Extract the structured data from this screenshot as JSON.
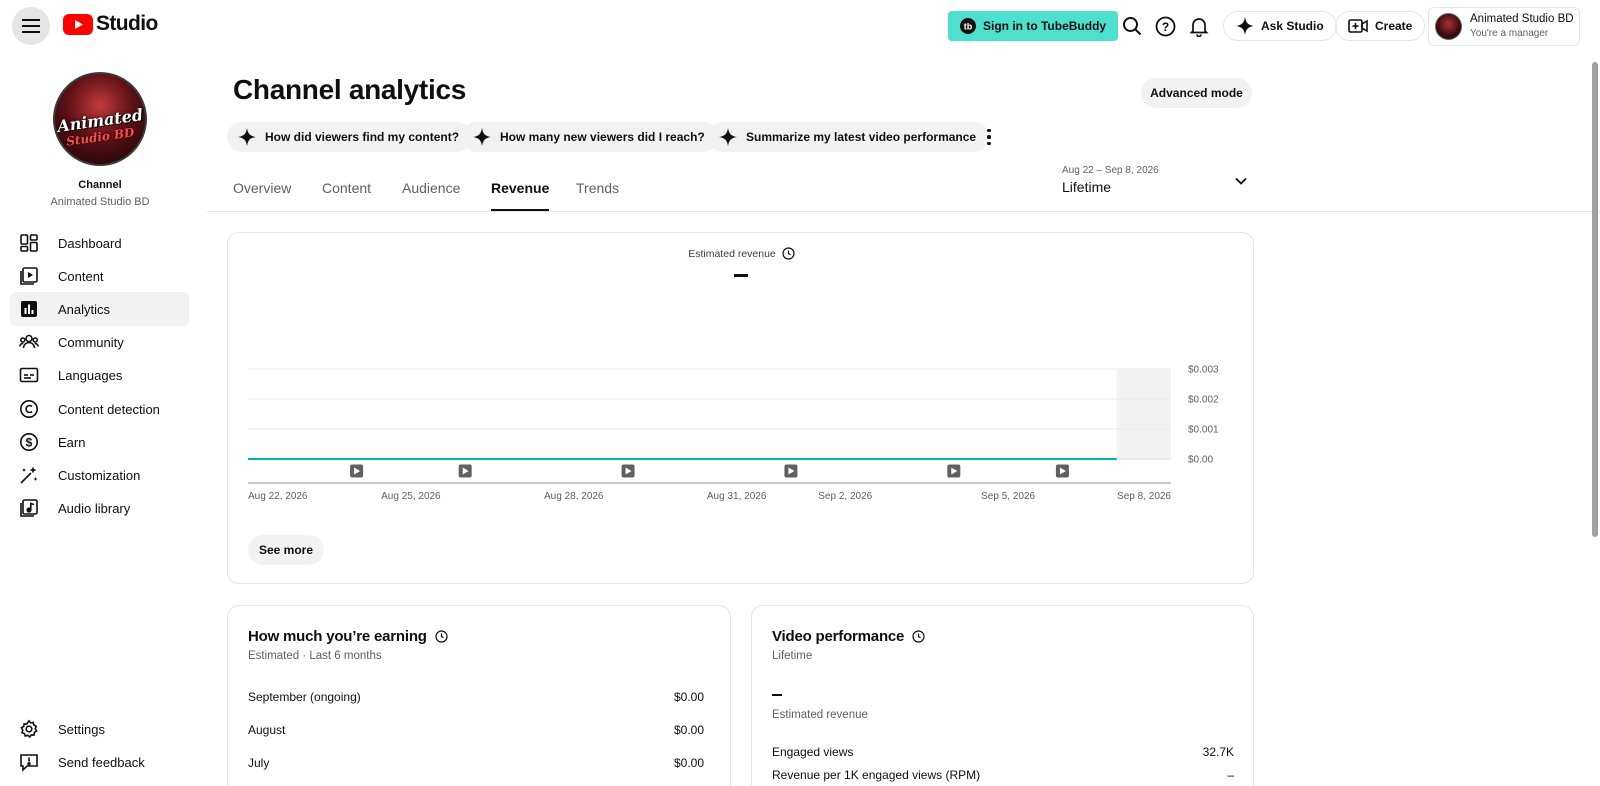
{
  "app": {
    "brand": "Studio",
    "tubebuddy_label": "Sign in to TubeBuddy",
    "ask_studio_label": "Ask Studio",
    "create_label": "Create",
    "account_name": "Animated Studio BD",
    "account_role": "You're a manager",
    "brand_color": "#ff0000",
    "tubebuddy_color": "#4de0cf"
  },
  "sidebar": {
    "channel_label": "Channel",
    "channel_name": "Animated Studio BD",
    "avatar_text_1": "Animated",
    "avatar_text_2": "Studio BD",
    "items": [
      {
        "label": "Dashboard",
        "icon": "dashboard-icon"
      },
      {
        "label": "Content",
        "icon": "content-icon"
      },
      {
        "label": "Analytics",
        "icon": "analytics-icon",
        "active": true
      },
      {
        "label": "Community",
        "icon": "community-icon"
      },
      {
        "label": "Languages",
        "icon": "languages-icon"
      },
      {
        "label": "Content detection",
        "icon": "copyright-icon"
      },
      {
        "label": "Earn",
        "icon": "earn-icon"
      },
      {
        "label": "Customization",
        "icon": "customization-icon"
      },
      {
        "label": "Audio library",
        "icon": "audio-library-icon"
      }
    ],
    "footer": [
      {
        "label": "Settings",
        "icon": "gear-icon"
      },
      {
        "label": "Send feedback",
        "icon": "feedback-icon"
      }
    ]
  },
  "main": {
    "title": "Channel analytics",
    "advanced_mode": "Advanced mode",
    "chips": [
      "How did viewers find my content?",
      "How many new viewers did I reach?",
      "Summarize my latest video performance"
    ],
    "tabs": [
      "Overview",
      "Content",
      "Audience",
      "Revenue",
      "Trends"
    ],
    "active_tab": "Revenue",
    "date_range": {
      "dates": "Aug 22 – Sep 8, 2026",
      "period": "Lifetime"
    }
  },
  "chart": {
    "metric_label": "Estimated revenue",
    "see_more": "See more"
  },
  "chart_data": {
    "type": "line",
    "title": "Estimated revenue",
    "x_ticks": [
      "Aug 22, 2026",
      "Aug 25, 2026",
      "Aug 28, 2026",
      "Aug 31, 2026",
      "Sep 2, 2026",
      "Sep 5, 2026",
      "Sep 8, 2026"
    ],
    "y_ticks": [
      "$0.003",
      "$0.002",
      "$0.001",
      "$0.00"
    ],
    "ylim": [
      0,
      0.003
    ],
    "x_start": "2026-08-22",
    "x_end": "2026-09-08",
    "series": [
      {
        "color": "#00b3a4",
        "x": [
          "2026-08-22",
          "2026-08-23",
          "2026-08-24",
          "2026-08-25",
          "2026-08-26",
          "2026-08-27",
          "2026-08-28",
          "2026-08-29",
          "2026-08-30",
          "2026-08-31",
          "2026-09-01",
          "2026-09-02",
          "2026-09-03",
          "2026-09-04",
          "2026-09-05",
          "2026-09-06",
          "2026-09-07"
        ],
        "values": [
          0,
          0,
          0,
          0,
          0,
          0,
          0,
          0,
          0,
          0,
          0,
          0,
          0,
          0,
          0,
          0,
          0
        ]
      }
    ],
    "video_markers": [
      "2026-08-24",
      "2026-08-26",
      "2026-08-29",
      "2026-09-01",
      "2026-09-04",
      "2026-09-06"
    ],
    "shaded_range": [
      "2026-09-07",
      "2026-09-08"
    ],
    "grid": true
  },
  "earnings": {
    "title": "How much you’re earning",
    "subtitle": "Estimated · Last 6 months",
    "rows": [
      {
        "month": "September (ongoing)",
        "value": "$0.00"
      },
      {
        "month": "August",
        "value": "$0.00"
      },
      {
        "month": "July",
        "value": "$0.00"
      }
    ]
  },
  "performance": {
    "title": "Video performance",
    "subtitle": "Lifetime",
    "revenue_label": "Estimated revenue",
    "rows": [
      {
        "label": "Engaged views",
        "value": "32.7K"
      },
      {
        "label": "Revenue per 1K engaged views (RPM)",
        "value": "–"
      }
    ]
  }
}
